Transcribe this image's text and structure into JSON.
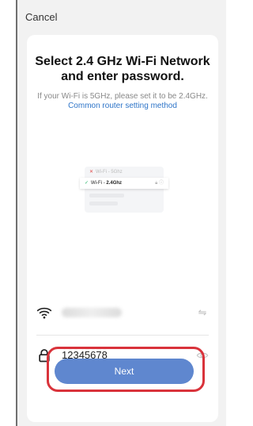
{
  "header": {
    "cancel_label": "Cancel"
  },
  "card": {
    "title": "Select 2.4 GHz Wi-Fi Network and enter password.",
    "subtitle": "If your Wi-Fi is 5GHz, please set it to be 2.4GHz.",
    "subtitle_link": "Common router setting method"
  },
  "illustration": {
    "row1": "Wi-Fi - 5Ghz",
    "row2_prefix": "Wi-Fi - ",
    "row2_bold": "2.4Ghz"
  },
  "form": {
    "password_value": "12345678"
  },
  "actions": {
    "next_label": "Next"
  },
  "colors": {
    "accent": "#5f87cf",
    "link": "#2e75c8",
    "highlight": "#d9333b"
  }
}
